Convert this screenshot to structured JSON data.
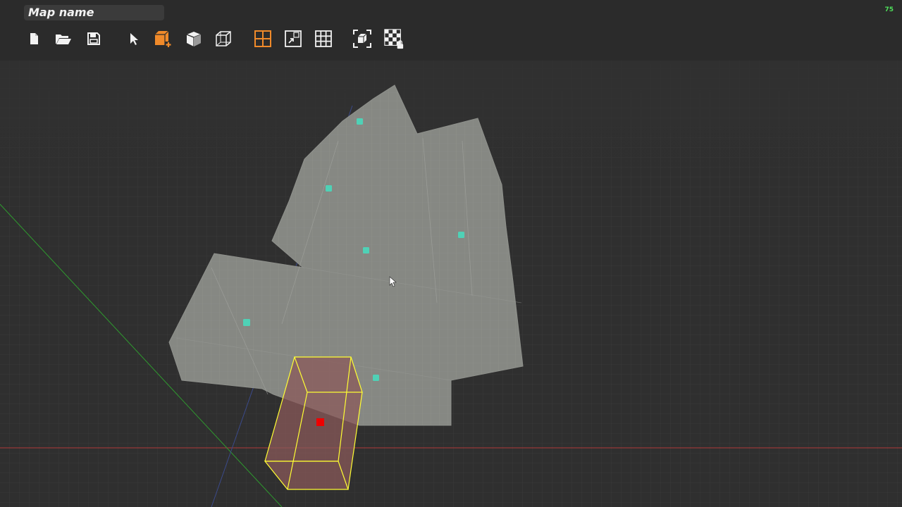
{
  "map": {
    "name": "Map name"
  },
  "status": {
    "fps": "75"
  },
  "toolbar": {
    "tools": [
      {
        "name": "new-file-icon",
        "active": false
      },
      {
        "name": "open-folder-icon",
        "active": false
      },
      {
        "name": "save-icon",
        "active": false
      },
      {
        "name": "select-pointer-icon",
        "active": false
      },
      {
        "name": "add-brush-icon",
        "active": true
      },
      {
        "name": "solid-view-icon",
        "active": false
      },
      {
        "name": "wireframe-view-icon",
        "active": false
      },
      {
        "name": "grid-view-icon",
        "active": true
      },
      {
        "name": "snap-icon",
        "active": false
      },
      {
        "name": "grid-toggle-icon",
        "active": false
      },
      {
        "name": "focus-selection-icon",
        "active": false
      },
      {
        "name": "texture-lock-icon",
        "active": false
      }
    ]
  },
  "colors": {
    "toolbar_bg": "#2b2b2b",
    "icon": "#f2f2f2",
    "icon_active": "#f08a2a",
    "grid": "#3a3a3a",
    "mesh": "#878984",
    "entity": "#4fd1b6",
    "selection_outline": "#ffff33",
    "selection_fill": "#8a5a5a",
    "selection_origin": "#ee0000",
    "axis_x": "#b23a3a",
    "axis_y": "#2f9a2f"
  }
}
